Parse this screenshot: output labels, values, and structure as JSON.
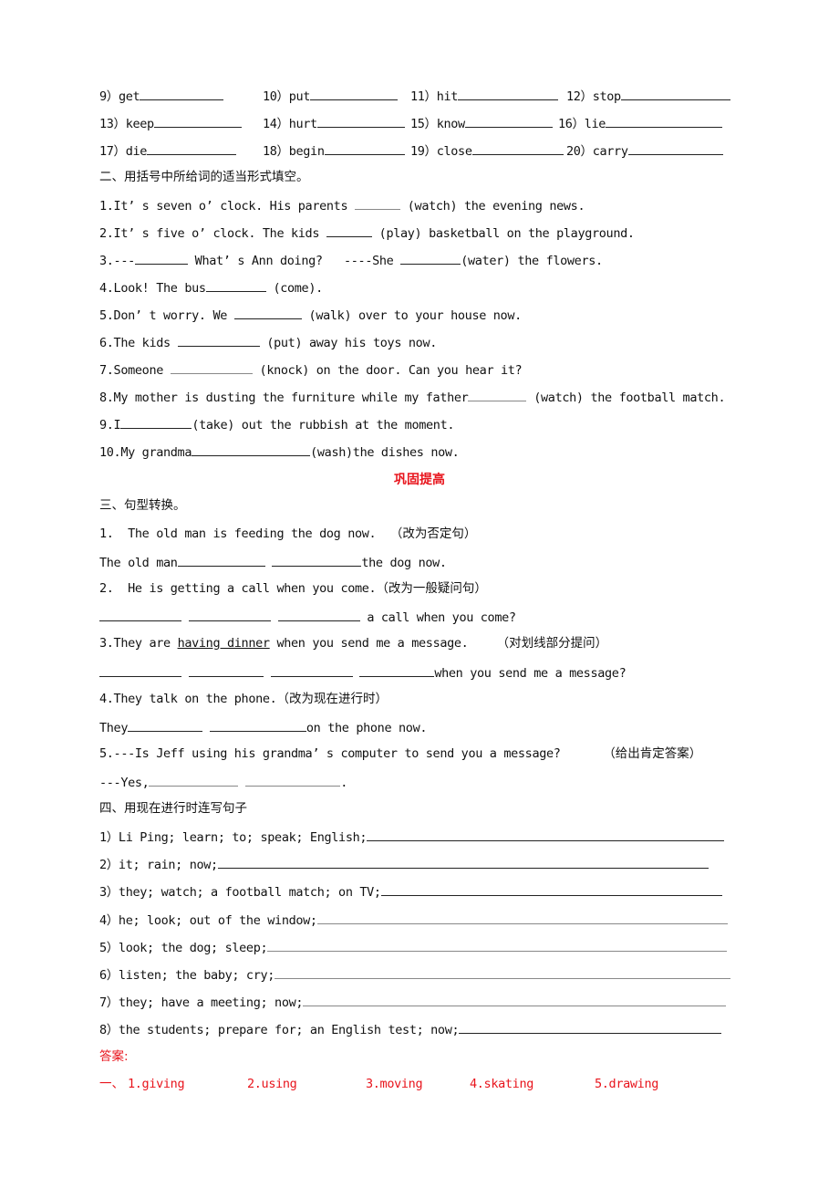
{
  "verbs": [
    {
      "num": "9）",
      "word": "get"
    },
    {
      "num": "10）",
      "word": "put"
    },
    {
      "num": "11）",
      "word": "hit"
    },
    {
      "num": "12）",
      "word": "stop"
    },
    {
      "num": "13）",
      "word": "keep"
    },
    {
      "num": "14）",
      "word": "hurt"
    },
    {
      "num": "15）",
      "word": "know"
    },
    {
      "num": "16）",
      "word": "lie"
    },
    {
      "num": "17）",
      "word": "die"
    },
    {
      "num": "18）",
      "word": "begin"
    },
    {
      "num": "19）",
      "word": "close"
    },
    {
      "num": "20）",
      "word": "carry"
    }
  ],
  "section2": {
    "heading": "二、用括号中所给词的适当形式填空。",
    "items": [
      {
        "pre": "1.It’ s seven o’ clock. His parents ",
        "post": " (watch) the evening news."
      },
      {
        "pre": "2.It’ s five o’ clock. The kids ",
        "post": " (play) basketball on the playground."
      },
      {
        "pre": "3.---",
        "mid": " What’ s Ann doing?   ----She ",
        "post": "(water) the flowers."
      },
      {
        "pre": "4.Look! The bus",
        "post": " (come)."
      },
      {
        "pre": "5.Don’ t worry. We ",
        "post": " (walk) over to your house now."
      },
      {
        "pre": "6.The kids ",
        "post": " (put) away his toys now."
      },
      {
        "pre": "7.Someone ",
        "post": " (knock) on the door. Can you hear it?"
      },
      {
        "pre": "8.My mother is dusting the furniture while my father",
        "post": " (watch) the football match."
      },
      {
        "pre": "9.I",
        "post": "(take) out the rubbish at the moment."
      },
      {
        "pre": "10.My grandma",
        "post": "(wash)the dishes now."
      }
    ]
  },
  "consolidate_title": "巩固提高",
  "section3": {
    "heading": "三、句型转换。",
    "q1": {
      "text": "1.  The old man is feeding the dog now.  ",
      "note": "（改为否定句）",
      "ans_pre": "The old man",
      "ans_post": "the dog now."
    },
    "q2": {
      "text": "2.  He is getting a call when you come.",
      "note": "（改为一般疑问句）",
      "ans_post": " a call when you come?"
    },
    "q3": {
      "pre": "3.They are ",
      "underlined": "having dinner",
      "post": " when you send me a message.    ",
      "note": "（对划线部分提问）",
      "ans_post": "when you send me a message?"
    },
    "q4": {
      "text": "4.They talk on the phone.",
      "note": "（改为现在进行时）",
      "ans_pre": "They",
      "ans_post": "on the phone now."
    },
    "q5": {
      "text": "5.---Is Jeff using his grandma’ s computer to send you a message?      ",
      "note": "（给出肯定答案）",
      "ans_pre": "---Yes,",
      "ans_post": "."
    }
  },
  "section4": {
    "heading": "四、用现在进行时连写句子",
    "items": [
      "1）Li Ping; learn; to; speak; English;",
      "2）it; rain; now;",
      "3）they; watch; a football match; on TV;",
      "4）he; look; out of the window;",
      "5）look; the dog; sleep;",
      "6）listen; the baby; cry;",
      "7）they; have a meeting; now;",
      "8）the students; prepare for; an English test; now;"
    ]
  },
  "answers": {
    "heading": "答案:",
    "prefix": "一、",
    "items": [
      "1.giving",
      "2.using",
      "3.moving",
      "4.skating",
      "5.drawing"
    ]
  },
  "colors": {
    "accent_red": "#e8141c",
    "text": "#111111"
  }
}
